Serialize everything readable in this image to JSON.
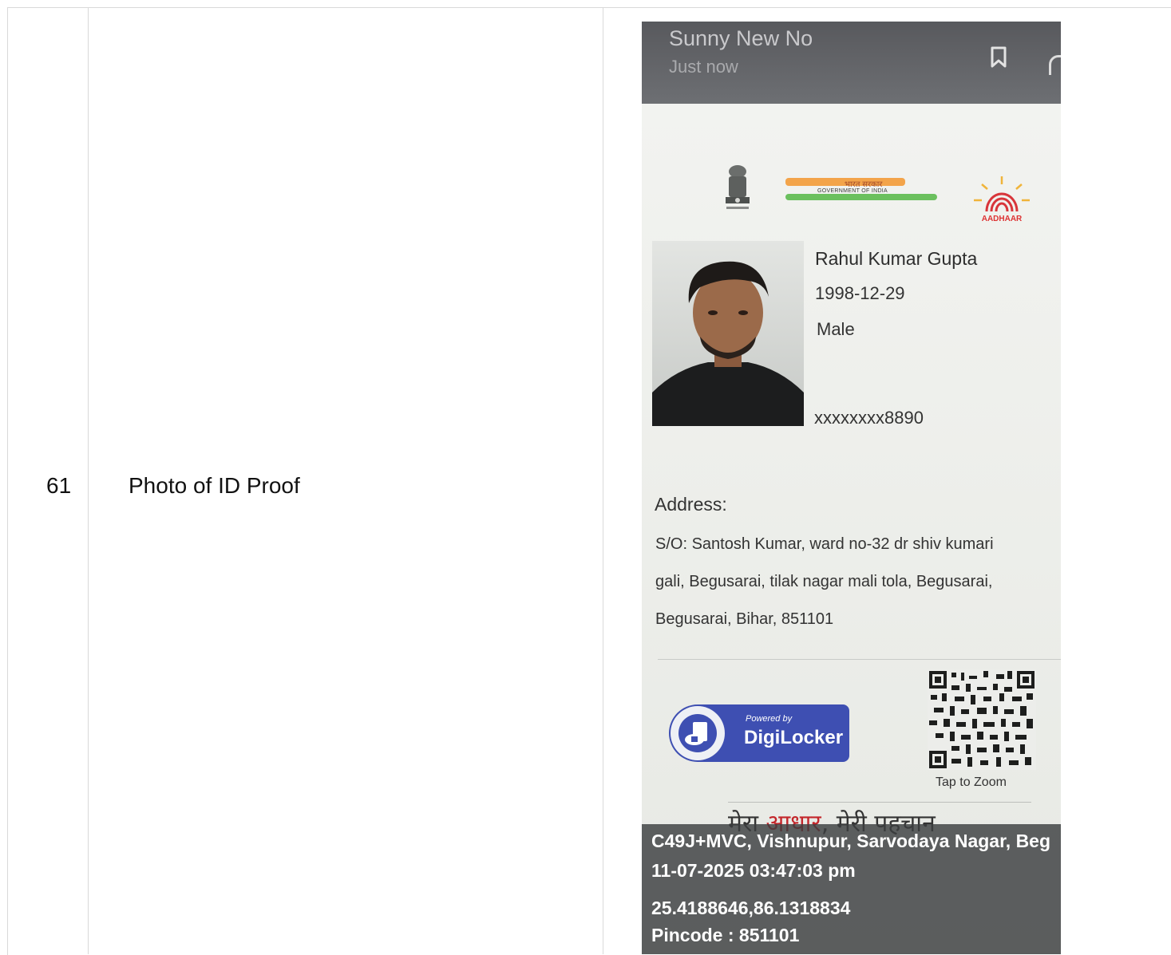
{
  "row": {
    "number": "61",
    "label": "Photo of ID Proof"
  },
  "photo": {
    "notification": {
      "sender": "Sunny New No",
      "time": "Just now"
    },
    "card": {
      "govt_hindi": "भारत सरकार",
      "govt_english": "GOVERNMENT OF INDIA",
      "aadhaar_logo_text": "AADHAAR",
      "name": "Rahul Kumar Gupta",
      "dob": "1998-12-29",
      "gender": "Male",
      "masked_number": "xxxxxxxx8890",
      "address_title": "Address:",
      "address_lines": [
        "S/O: Santosh Kumar, ward no-32 dr shiv kumari",
        "gali, Begusarai, tilak nagar mali tola, Begusarai,",
        "Begusarai, Bihar, 851101"
      ],
      "digilocker": {
        "powered_by": "Powered by",
        "name": "DigiLocker"
      },
      "qr_caption": "Tap to Zoom",
      "tagline_part1": "मेरा ",
      "tagline_part2": "आधार",
      "tagline_part3": ", मेरी पहचान"
    },
    "geo_overlay": {
      "location": "C49J+MVC, Vishnupur, Sarvodaya Nagar, Beg",
      "timestamp": "11-07-2025 03:47:03 pm",
      "coordinates": "25.4188646,86.1318834",
      "pincode": "Pincode : 851101"
    }
  }
}
